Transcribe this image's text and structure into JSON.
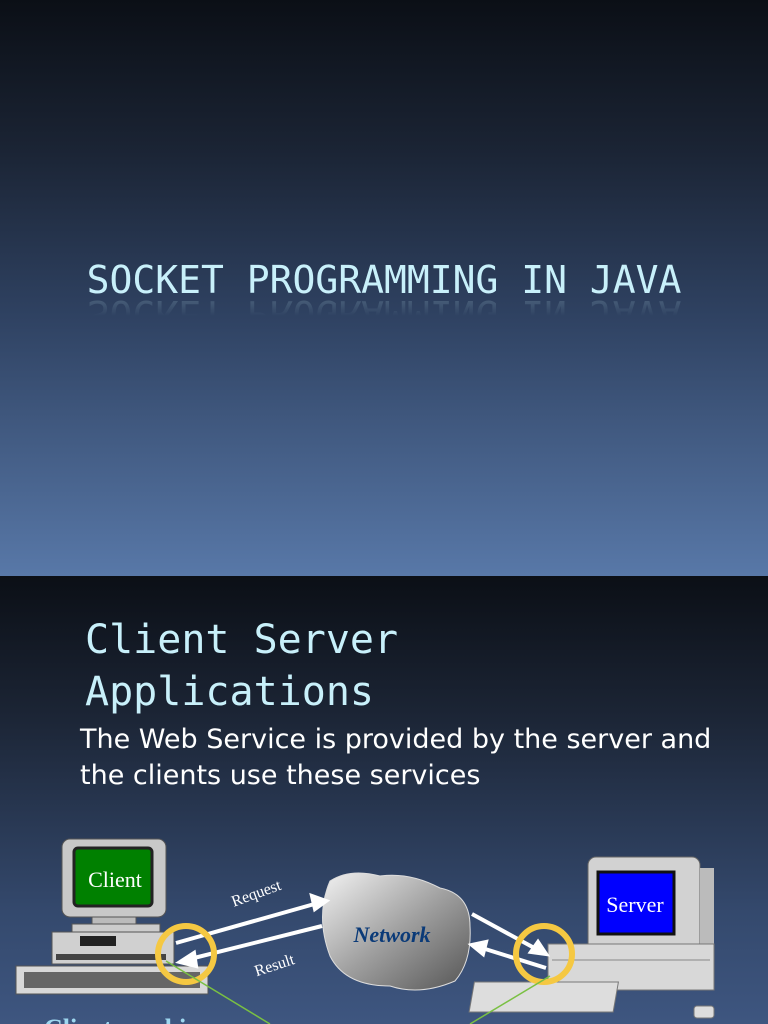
{
  "slide1": {
    "title": "SOCKET PROGRAMMING IN JAVA"
  },
  "slide2": {
    "title": "Client Server Applications",
    "body": "The Web Service is provided by the server and the clients use these services",
    "diagram": {
      "client_label": "Client",
      "server_label": "Server",
      "network_label": "Network",
      "request_label": "Request",
      "result_label": "Result",
      "client_caption": "Client machine"
    },
    "colors": {
      "client_screen": "#008000",
      "server_screen": "#0000ff",
      "ring": "#f5c842",
      "link_line": "#7ac043"
    }
  }
}
